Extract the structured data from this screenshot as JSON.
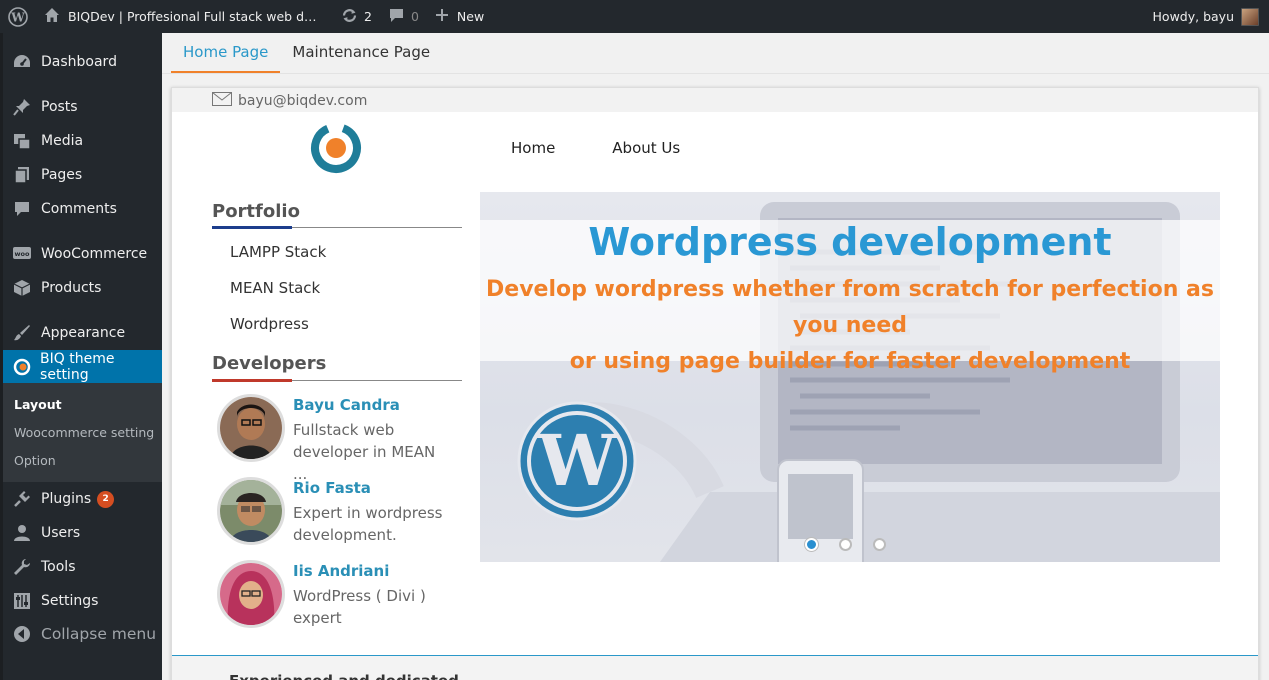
{
  "adminbar": {
    "site_title": "BIQDev | Proffesional Full stack web dev...",
    "updates_count": "2",
    "comments_count": "0",
    "new_label": "New",
    "howdy": "Howdy, bayu"
  },
  "sidebar": {
    "items": [
      {
        "label": "Dashboard",
        "icon": "dashboard-icon"
      },
      {
        "label": "Posts",
        "icon": "pin-icon"
      },
      {
        "label": "Media",
        "icon": "media-icon"
      },
      {
        "label": "Pages",
        "icon": "pages-icon"
      },
      {
        "label": "Comments",
        "icon": "comment-icon"
      },
      {
        "label": "WooCommerce",
        "icon": "woo-icon"
      },
      {
        "label": "Products",
        "icon": "box-icon"
      },
      {
        "label": "Appearance",
        "icon": "brush-icon"
      },
      {
        "label": "BIQ theme setting",
        "icon": "biq-icon"
      },
      {
        "label": "Plugins",
        "icon": "plug-icon",
        "badge": "2"
      },
      {
        "label": "Users",
        "icon": "user-icon"
      },
      {
        "label": "Tools",
        "icon": "wrench-icon"
      },
      {
        "label": "Settings",
        "icon": "settings-icon"
      }
    ],
    "submenu": [
      "Layout",
      "Woocommerce setting",
      "Option"
    ],
    "collapse_label": "Collapse menu"
  },
  "tabs": [
    "Home Page",
    "Maintenance Page"
  ],
  "preview": {
    "email": "bayu@biqdev.com",
    "nav": [
      "Home",
      "About Us"
    ],
    "portfolio_title": "Portfolio",
    "portfolio_links": [
      "LAMPP Stack",
      "MEAN Stack",
      "Wordpress"
    ],
    "developers_title": "Developers",
    "developers": [
      {
        "name": "Bayu Candra",
        "desc": "Fullstack web",
        "desc2": "developer in MEAN ..."
      },
      {
        "name": "Rio Fasta",
        "desc": "Expert in wordpress",
        "desc2": "development."
      },
      {
        "name": "Iis Andriani",
        "desc": "WordPress ( Divi )",
        "desc2": "expert"
      }
    ],
    "slider": {
      "title": "Wordpress development",
      "subtitle_line1": "Develop wordpress whether from scratch for perfection as you need",
      "subtitle_line2": "or using page builder for faster development",
      "active_slide": 1,
      "slide_count": 3
    },
    "bottom_text": "Experienced and dedicated"
  },
  "colors": {
    "admin_dark": "#23282d",
    "wp_blue": "#0073aa",
    "accent_blue": "#2a98d4",
    "accent_orange": "#f0812a",
    "badge_red": "#d54e21"
  }
}
